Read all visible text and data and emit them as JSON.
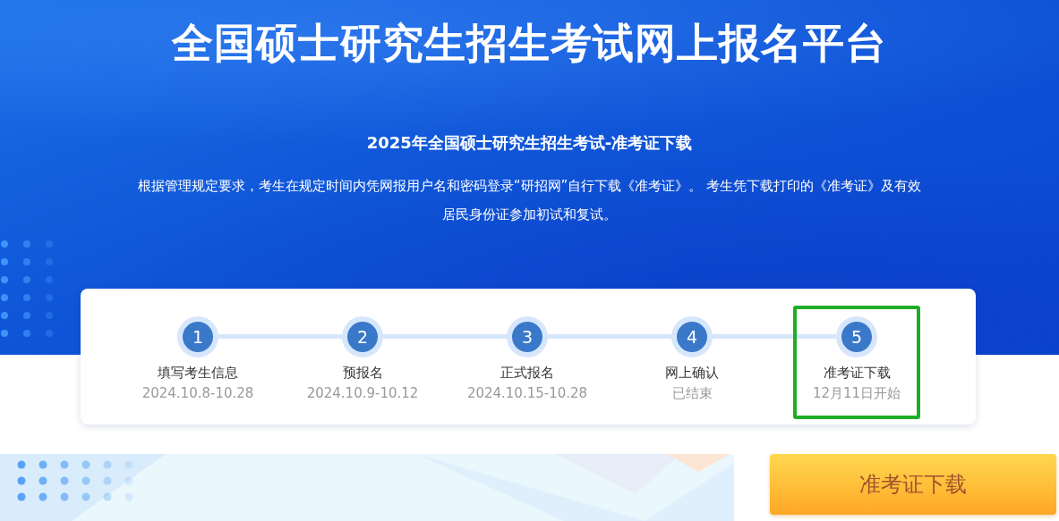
{
  "header": {
    "title": "全国硕士研究生招生考试网上报名平台",
    "subtitle": "2025年全国硕士研究生招生考试-准考证下载",
    "notice": "根据管理规定要求，考生在规定时间内凭网报用户名和密码登录“研招网”自行下载《准考证》。 考生凭下载打印的《准考证》及有效居民身份证参加初试和复试。"
  },
  "steps": [
    {
      "number": "1",
      "label": "填写考生信息",
      "date": "2024.10.8-10.28",
      "selected": false
    },
    {
      "number": "2",
      "label": "预报名",
      "date": "2024.10.9-10.12",
      "selected": false
    },
    {
      "number": "3",
      "label": "正式报名",
      "date": "2024.10.15-10.28",
      "selected": false
    },
    {
      "number": "4",
      "label": "网上确认",
      "date": "已结束",
      "selected": false
    },
    {
      "number": "5",
      "label": "准考证下载",
      "date": "12月11日开始",
      "selected": true
    }
  ],
  "download_button": {
    "label": "准考证下载"
  }
}
